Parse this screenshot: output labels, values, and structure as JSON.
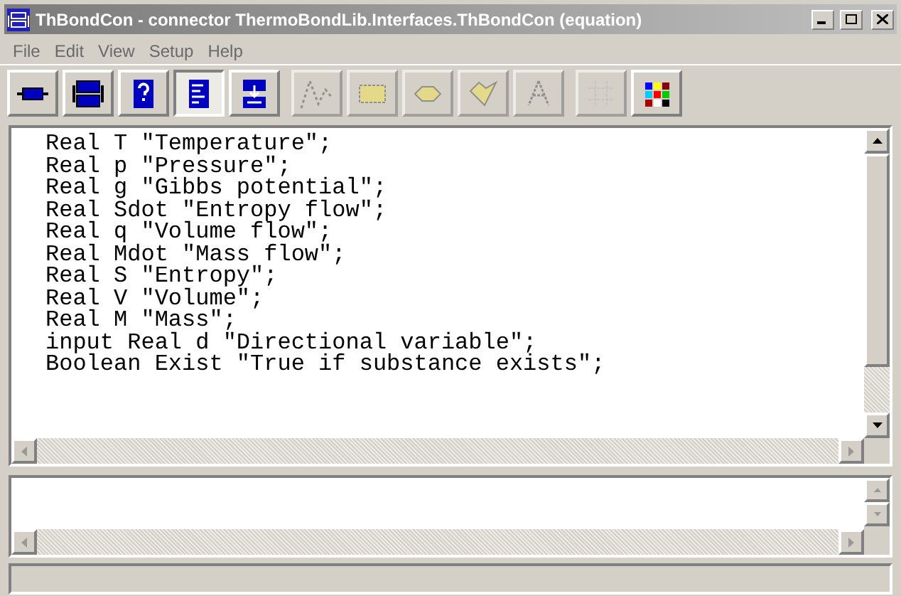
{
  "window": {
    "title": "ThBondCon - connector ThermoBondLib.Interfaces.ThBondCon (equation)"
  },
  "menu": [
    "File",
    "Edit",
    "View",
    "Setup",
    "Help"
  ],
  "toolbar": {
    "groups": [
      [
        {
          "selected": false,
          "disabled": false
        },
        {
          "selected": false,
          "disabled": false
        },
        {
          "selected": false,
          "disabled": false
        },
        {
          "selected": true,
          "disabled": false
        },
        {
          "selected": false,
          "disabled": false
        }
      ],
      [
        {
          "selected": false,
          "disabled": true
        },
        {
          "selected": false,
          "disabled": true
        },
        {
          "selected": false,
          "disabled": true
        },
        {
          "selected": false,
          "disabled": true
        },
        {
          "selected": false,
          "disabled": true
        }
      ],
      [
        {
          "selected": false,
          "disabled": true
        },
        {
          "selected": false,
          "disabled": false
        }
      ]
    ]
  },
  "editor": {
    "lines": [
      "Real T \"Temperature\";",
      "Real p \"Pressure\";",
      "Real g \"Gibbs potential\";",
      "Real Sdot \"Entropy flow\";",
      "Real q \"Volume flow\";",
      "Real Mdot \"Mass flow\";",
      "Real S \"Entropy\";",
      "Real V \"Volume\";",
      "Real M \"Mass\";",
      "input Real d \"Directional variable\";",
      "Boolean Exist \"True if substance exists\";"
    ]
  }
}
